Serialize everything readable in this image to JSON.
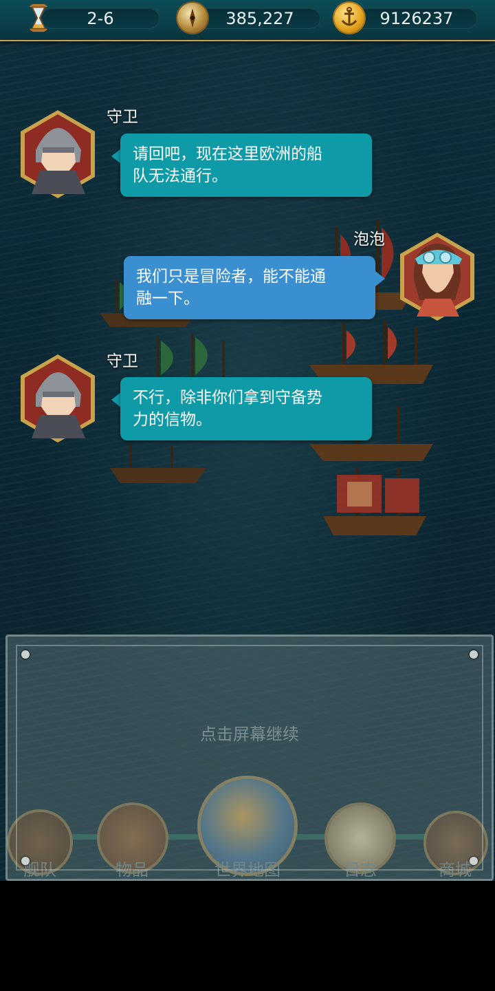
{
  "topbar": {
    "level": "2-6",
    "compass_value": "385,227",
    "gold_value": "9126237",
    "icons": [
      "hourglass-icon",
      "compass-icon",
      "anchor-coin-icon"
    ]
  },
  "dialogue": [
    {
      "speaker": "守卫",
      "line1": "请回吧，现在这里欧洲的船",
      "line2": "队无法通行。",
      "side": "left"
    },
    {
      "speaker": "泡泡",
      "line1": "我们只是冒险者，能不能通",
      "line2": "融一下。",
      "side": "right"
    },
    {
      "speaker": "守卫",
      "line1": "不行，除非你们拿到守备势",
      "line2": "力的信物。",
      "side": "left"
    }
  ],
  "overlay": {
    "prompt": "点击屏幕继续"
  },
  "nav": {
    "fleet": "舰队",
    "items": "物品",
    "world_map": "世界地图",
    "log": "日志",
    "shop": "商城"
  },
  "colors": {
    "guard_bubble": "#0f9aa8",
    "player_bubble": "#3a8fd0",
    "accent_gold": "#c9a24d"
  }
}
